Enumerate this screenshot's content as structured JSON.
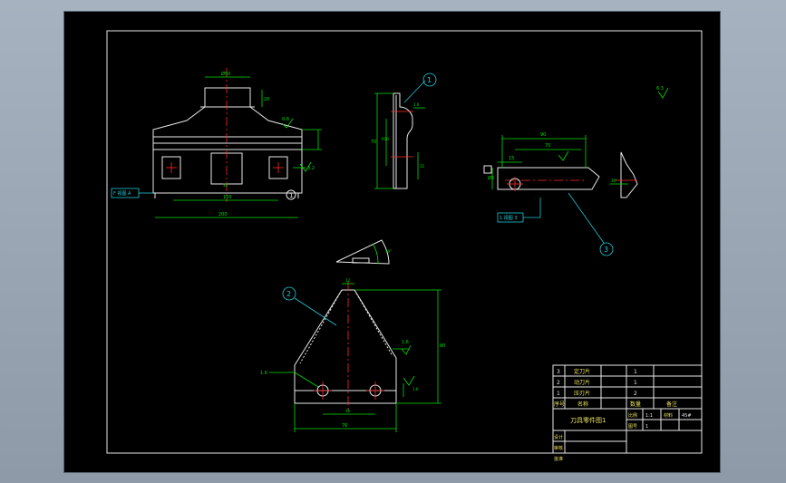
{
  "balloons": {
    "b1": "1",
    "b2": "2",
    "b3": "3",
    "b1_small": "1"
  },
  "labels": {
    "top_view_tag": "F 视图 A",
    "right_view_tag": "1 视图 3",
    "roughness_global": "6.3",
    "roughness_1": "0.8",
    "roughness_2": "1.6",
    "roughness_3": "1.6",
    "hole_note": "1.6"
  },
  "title_block": {
    "parts": [
      {
        "no": "3",
        "name": "定刀片",
        "qty": "1",
        "remark": ""
      },
      {
        "no": "2",
        "name": "动刀片",
        "qty": "1",
        "remark": ""
      },
      {
        "no": "1",
        "name": "压刃片",
        "qty": "2",
        "remark": ""
      }
    ],
    "header": {
      "no": "序号",
      "name": "名称",
      "qty": "数量",
      "remark": "备注"
    },
    "drawing_name": "刀具零件图1",
    "scale_label": "比例",
    "scale_value": "1:1",
    "material_label": "材料",
    "material_value": "45#",
    "sheet_label": "图号",
    "sheet_value": "1",
    "designer": "设计",
    "checker": "审核",
    "approver": "批准"
  }
}
